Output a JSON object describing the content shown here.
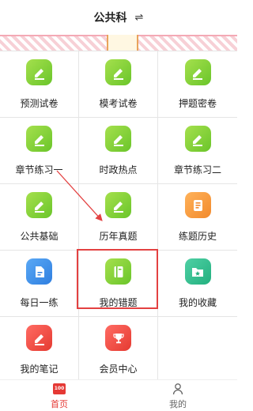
{
  "header": {
    "title": "公共科",
    "switch_icon": "⇌"
  },
  "grid": [
    [
      {
        "label": "预测试卷",
        "color": "green",
        "icon": "pencil-icon"
      },
      {
        "label": "模考试卷",
        "color": "green",
        "icon": "pencil-icon"
      },
      {
        "label": "押题密卷",
        "color": "green",
        "icon": "pencil-icon"
      }
    ],
    [
      {
        "label": "章节练习一",
        "color": "green",
        "icon": "pencil-icon"
      },
      {
        "label": "时政热点",
        "color": "green",
        "icon": "pencil-icon"
      },
      {
        "label": "章节练习二",
        "color": "green",
        "icon": "pencil-icon"
      }
    ],
    [
      {
        "label": "公共基础",
        "color": "green",
        "icon": "pencil-icon"
      },
      {
        "label": "历年真题",
        "color": "green",
        "icon": "pencil-icon"
      },
      {
        "label": "练题历史",
        "color": "orange",
        "icon": "scroll-icon"
      }
    ],
    [
      {
        "label": "每日一练",
        "color": "blue",
        "icon": "document-icon"
      },
      {
        "label": "我的错题",
        "color": "green",
        "icon": "notebook-icon"
      },
      {
        "label": "我的收藏",
        "color": "teal",
        "icon": "folder-star-icon"
      }
    ],
    [
      {
        "label": "我的笔记",
        "color": "red",
        "icon": "pencil-icon"
      },
      {
        "label": "会员中心",
        "color": "red",
        "icon": "trophy-icon"
      }
    ]
  ],
  "tabbar": {
    "home": {
      "label": "首页",
      "badge": "100"
    },
    "mine": {
      "label": "我的"
    }
  },
  "colors": {
    "accent": "#e53935",
    "green": "#6ac52a",
    "highlight": "#e34141"
  }
}
